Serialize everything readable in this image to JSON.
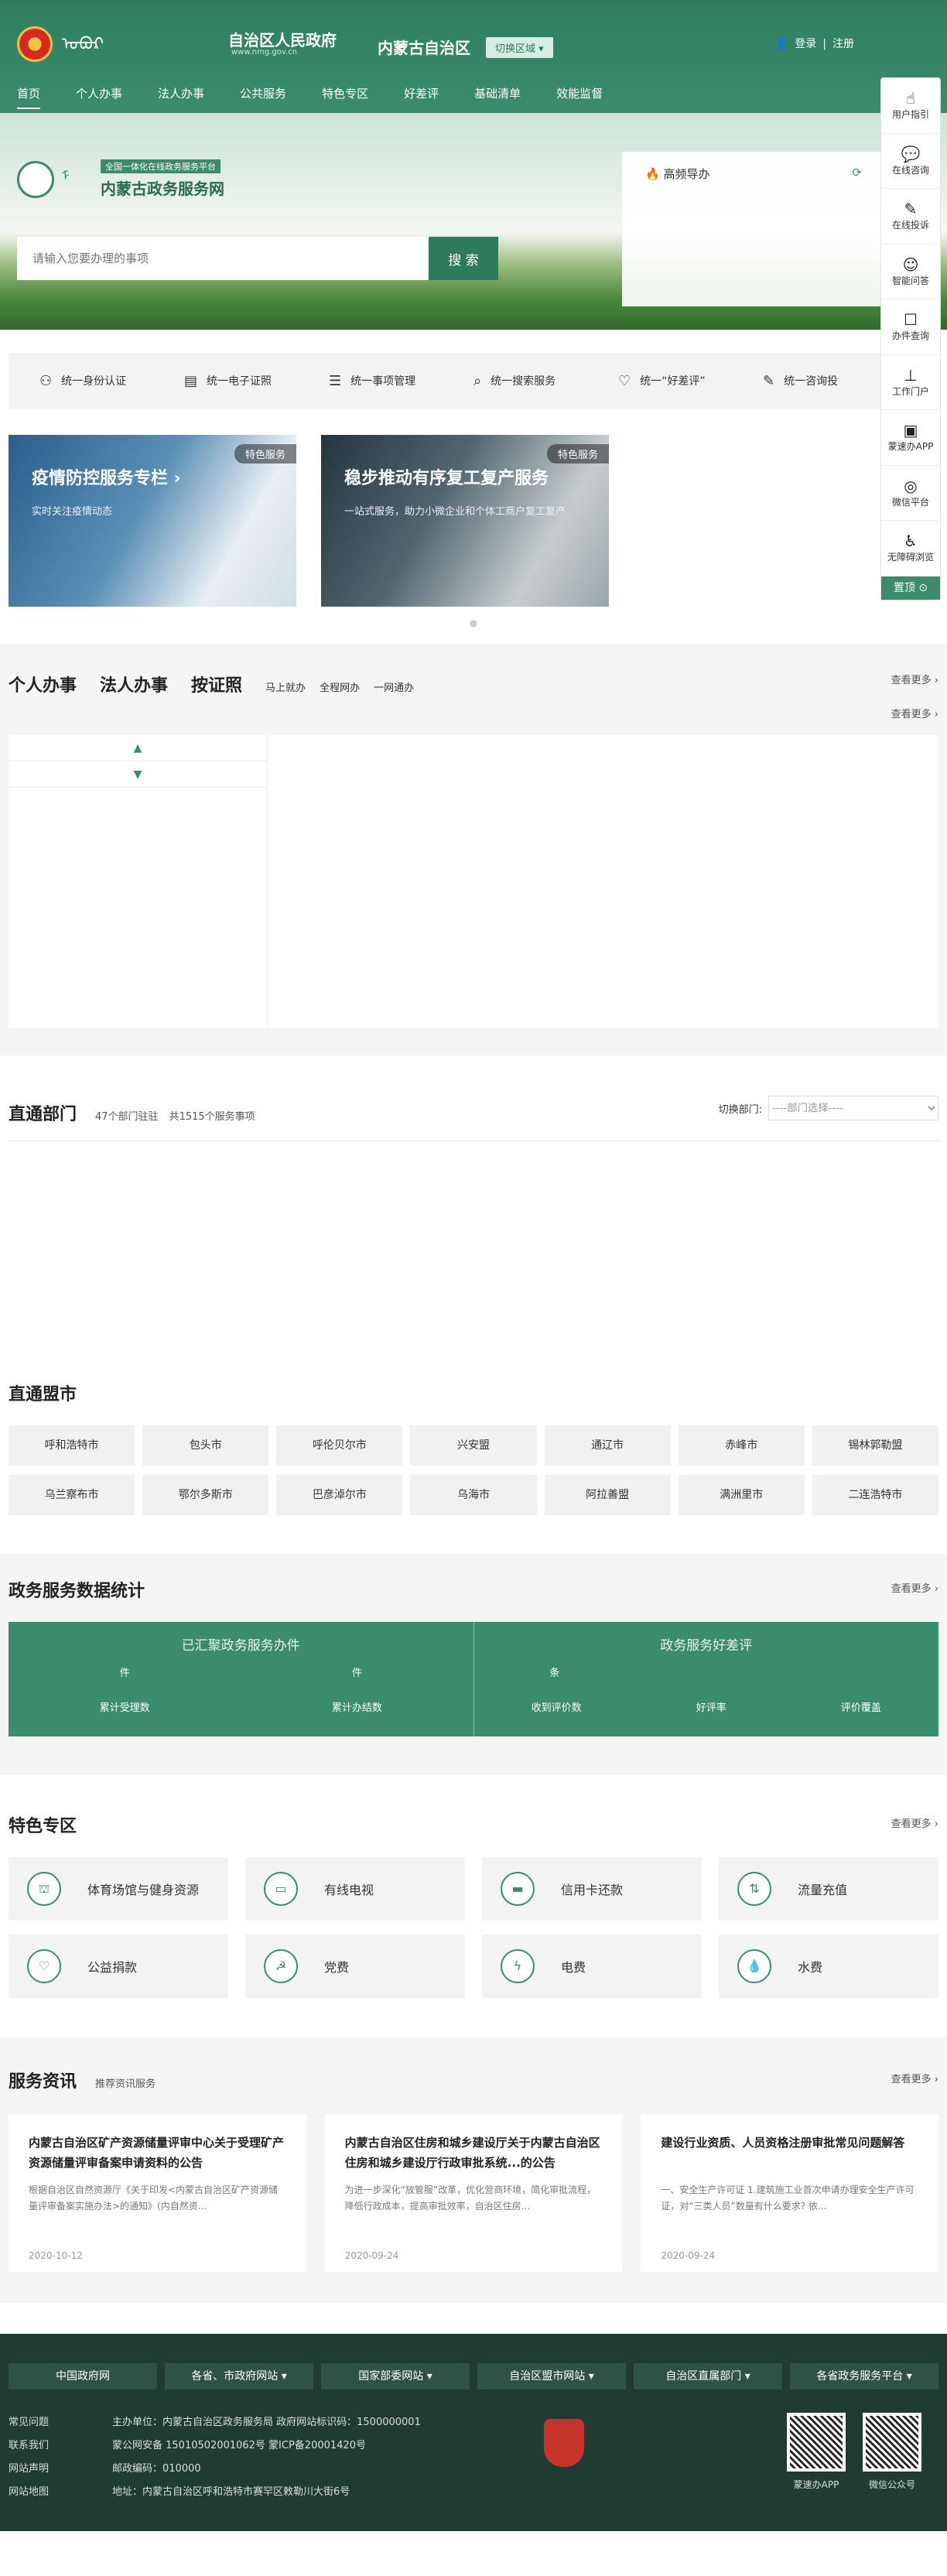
{
  "header": {
    "mongol_text": "ᠣᠪᠣᠷ ᠮᠣᠩᠭᠣᠯ",
    "gov_name": "自治区人民政府",
    "gov_url": "www.nmg.gov.cn",
    "region": "内蒙古自治区",
    "switch_label": "切换区域",
    "login": "登录",
    "register": "注册"
  },
  "nav": [
    "首页",
    "个人办事",
    "法人办事",
    "公共服务",
    "特色专区",
    "好差评",
    "基础清单",
    "效能监督"
  ],
  "banner": {
    "platform_tag": "全国一体化在线政务服务平台",
    "title": "内蒙古政务服务网",
    "search_placeholder": "请输入您要办理的事项",
    "search_button": "搜 索",
    "hot_title": "高频导办"
  },
  "side": [
    "用户指引",
    "在线咨询",
    "在线投诉",
    "智能问答",
    "办件查询",
    "工作门户",
    "蒙速办APP",
    "微信平台",
    "无障碍浏览"
  ],
  "side_top": "置顶",
  "unified": [
    "统一身份认证",
    "统一电子证照",
    "统一事项管理",
    "统一搜索服务",
    "统一“好差评”",
    "统一咨询投"
  ],
  "cards": [
    {
      "badge": "特色服务",
      "title": "疫情防控服务专栏  ›",
      "sub": "实时关注疫情动态"
    },
    {
      "badge": "特色服务",
      "title": "稳步推动有序复工复产服务",
      "sub": "一站式服务，助力小微企业和个体工商户复工复产"
    }
  ],
  "tabsec": {
    "tabs": [
      "个人办事",
      "法人办事",
      "按证照"
    ],
    "subs": [
      "马上就办",
      "全程网办",
      "一网通办"
    ],
    "more1": "查看更多  ›",
    "more2": "查看更多  ›"
  },
  "dept": {
    "title": "直通部门",
    "count1": "47个部门驻驻",
    "count2": "共1515个服务事项",
    "switch_label": "切换部门:",
    "select_placeholder": "----部门选择----"
  },
  "cities": {
    "title": "直通盟市",
    "items": [
      "呼和浩特市",
      "包头市",
      "呼伦贝尔市",
      "兴安盟",
      "通辽市",
      "赤峰市",
      "锡林郭勒盟",
      "乌兰察布市",
      "鄂尔多斯市",
      "巴彦淖尔市",
      "乌海市",
      "阿拉善盟",
      "满洲里市",
      "二连浩特市"
    ]
  },
  "stats": {
    "title": "政务服务数据统计",
    "more": "查看更多  ›",
    "left_title": "已汇聚政务服务办件",
    "right_title": "政务服务好差评",
    "unit1": "件",
    "unit2": "件",
    "unit3": "条",
    "l1": "累计受理数",
    "l2": "累计办结数",
    "r1": "收到评价数",
    "r2": "好评率",
    "r3": "评价覆盖"
  },
  "feature": {
    "title": "特色专区",
    "more": "查看更多  ›",
    "items": [
      "体育场馆与健身资源",
      "有线电视",
      "信用卡还款",
      "流量充值",
      "公益捐款",
      "党费",
      "电费",
      "水费"
    ]
  },
  "news": {
    "title": "服务资讯",
    "sub": "推荐资讯服务",
    "more": "查看更多  ›",
    "items": [
      {
        "title": "内蒙古自治区矿产资源储量评审中心关于受理矿产资源储量评审备案申请资料的公告",
        "desc": "根据自治区自然资源厅《关于印发<内蒙古自治区矿产资源储量评审备案实施办法>的通知》(内自然资...",
        "date": "2020-10-12"
      },
      {
        "title": "内蒙古自治区住房和城乡建设厅关于内蒙古自治区住房和城乡建设厅行政审批系统...的公告",
        "desc": "为进一步深化“放管服”改革，优化营商环境，简化审批流程，降低行政成本，提高审批效率，自治区住房...",
        "date": "2020-09-24"
      },
      {
        "title": "建设行业资质、人员资格注册审批常见问题解答",
        "desc": "一、安全生产许可证 1.建筑施工业首次申请办理安全生产许可证，对“三类人员”数量有什么要求? 依...",
        "date": "2020-09-24"
      }
    ]
  },
  "footer": {
    "links": [
      "中国政府网",
      "各省、市政府网站  ▾",
      "国家部委网站  ▾",
      "自治区盟市网站  ▾",
      "自治区直属部门  ▾",
      "各省政务服务平台  ▾"
    ],
    "left": [
      "常见问题",
      "联系我们",
      "网站声明",
      "网站地图"
    ],
    "info": [
      "主办单位：内蒙古自治区政务服务局    政府网站标识码：1500000001",
      "蒙公网安备 15010502001062号    蒙ICP备20001420号",
      "邮政编码：010000",
      "地址：内蒙古自治区呼和浩特市赛罕区敕勒川大街6号"
    ],
    "qr1": "蒙速办APP",
    "qr2": "微信公众号"
  },
  "colors": {
    "brand": "#3a8c6c",
    "footer": "#1f3c33"
  }
}
